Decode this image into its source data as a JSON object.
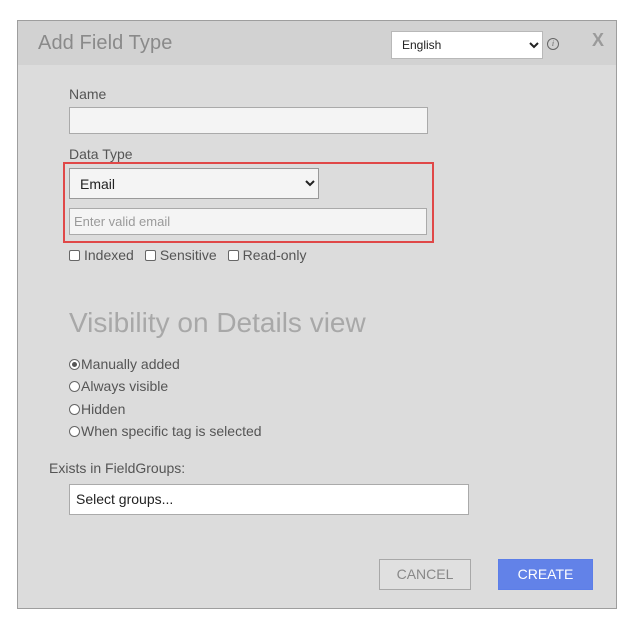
{
  "dialog": {
    "title": "Add Field Type",
    "language": {
      "selected": "English",
      "options": [
        "English"
      ]
    },
    "close_label": "X",
    "info_label": "i"
  },
  "form": {
    "name_label": "Name",
    "name_value": "",
    "data_type_label": "Data Type",
    "data_type": {
      "selected": "Email",
      "options": [
        "Email"
      ]
    },
    "email_placeholder": "Enter valid email",
    "checkboxes": [
      {
        "label": "Indexed",
        "checked": false
      },
      {
        "label": "Sensitive",
        "checked": false
      },
      {
        "label": "Read-only",
        "checked": false
      }
    ]
  },
  "visibility": {
    "heading": "Visibility on Details view",
    "options": [
      {
        "label": "Manually added",
        "checked": true
      },
      {
        "label": "Always visible",
        "checked": false
      },
      {
        "label": "Hidden",
        "checked": false
      },
      {
        "label": "When specific tag is selected",
        "checked": false
      }
    ]
  },
  "field_groups": {
    "label": "Exists in FieldGroups:",
    "placeholder": "Select groups..."
  },
  "buttons": {
    "cancel": "CANCEL",
    "create": "CREATE"
  },
  "colors": {
    "dialog_bg": "#dcdcdc",
    "highlight_border": "#e04848",
    "primary_button": "#6282e8"
  }
}
